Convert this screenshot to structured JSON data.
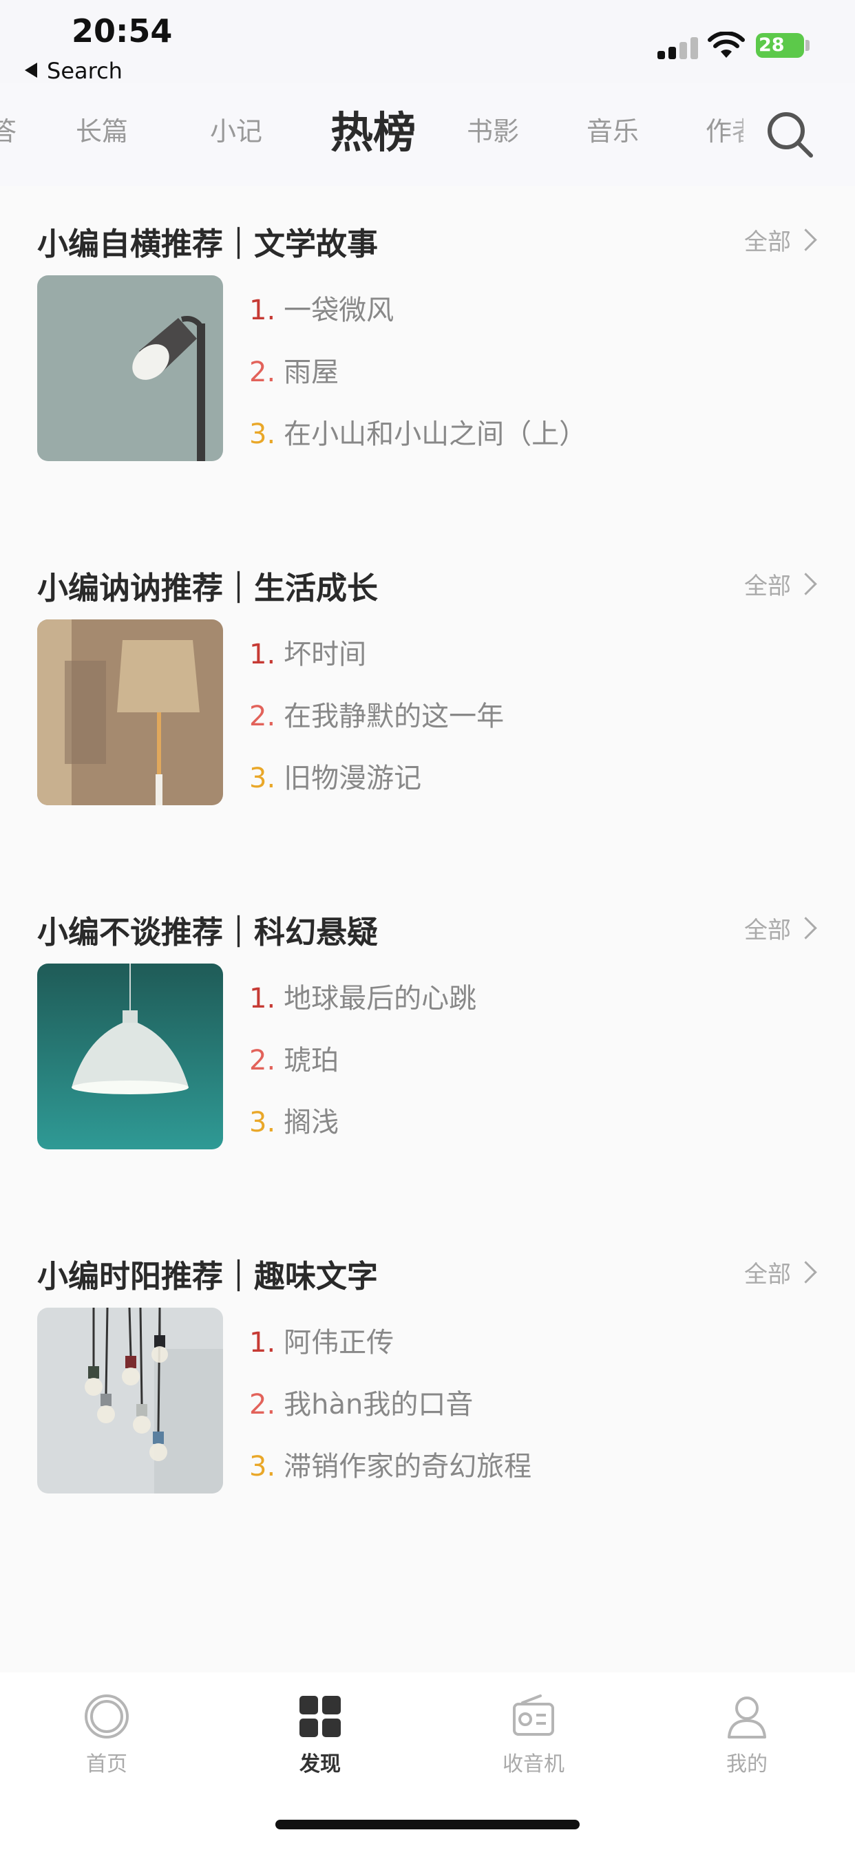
{
  "status_bar": {
    "time": "20:54",
    "back_label": "Search",
    "battery": "28"
  },
  "top_tabs": {
    "tabs": [
      {
        "label": "答"
      },
      {
        "label": "长篇"
      },
      {
        "label": "小记"
      },
      {
        "label": "热榜",
        "active": true
      },
      {
        "label": "书影"
      },
      {
        "label": "音乐"
      },
      {
        "label": "作者"
      }
    ],
    "search_icon": "search-icon"
  },
  "sections": [
    {
      "title": "小编自横推荐｜文学故事",
      "see_all": "全部",
      "image": "floor-lamp-photo",
      "items": [
        {
          "rank": "1.",
          "title": "一袋微风"
        },
        {
          "rank": "2.",
          "title": "雨屋"
        },
        {
          "rank": "3.",
          "title": "在小山和小山之间（上）"
        }
      ]
    },
    {
      "title": "小编讷讷推荐｜生活成长",
      "see_all": "全部",
      "image": "shade-lamp-photo",
      "items": [
        {
          "rank": "1.",
          "title": "坏时间"
        },
        {
          "rank": "2.",
          "title": "在我静默的这一年"
        },
        {
          "rank": "3.",
          "title": "旧物漫游记"
        }
      ]
    },
    {
      "title": "小编不谈推荐｜科幻悬疑",
      "see_all": "全部",
      "image": "pendant-lamp-photo",
      "items": [
        {
          "rank": "1.",
          "title": "地球最后的心跳"
        },
        {
          "rank": "2.",
          "title": "琥珀"
        },
        {
          "rank": "3.",
          "title": "搁浅"
        }
      ]
    },
    {
      "title": "小编时阳推荐｜趣味文字",
      "see_all": "全部",
      "image": "hanging-bulbs-photo",
      "items": [
        {
          "rank": "1.",
          "title": "阿伟正传"
        },
        {
          "rank": "2.",
          "title": "我hàn我的口音"
        },
        {
          "rank": "3.",
          "title": "滞销作家的奇幻旅程"
        }
      ]
    }
  ],
  "bottom_nav": {
    "items": [
      {
        "label": "首页",
        "icon": "home-icon"
      },
      {
        "label": "发现",
        "icon": "discover-icon",
        "active": true
      },
      {
        "label": "收音机",
        "icon": "radio-icon"
      },
      {
        "label": "我的",
        "icon": "profile-icon"
      }
    ]
  },
  "colors": {
    "rank1": "#c63a34",
    "rank2": "#e2625a",
    "rank3": "#e9a728"
  }
}
